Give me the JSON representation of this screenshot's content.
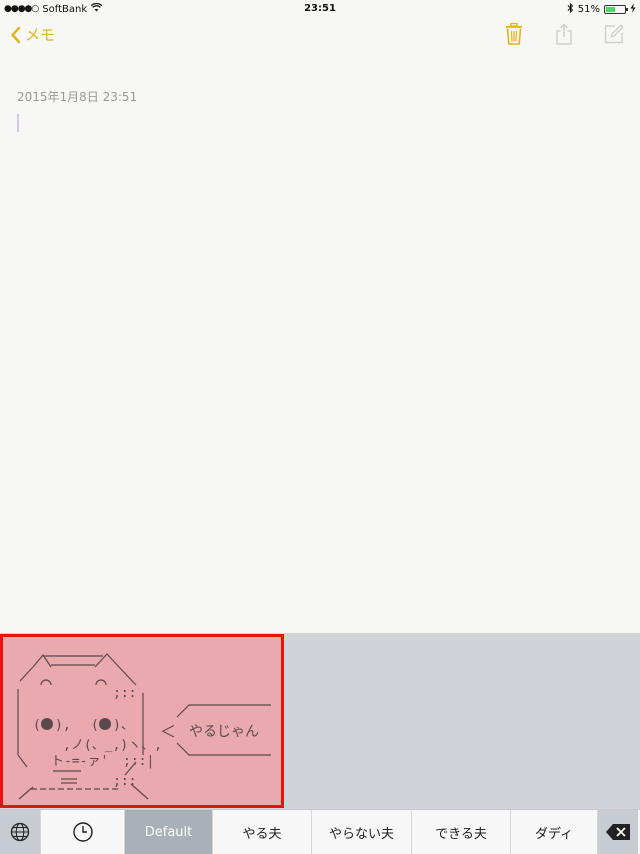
{
  "status_bar": {
    "signal": "●●●●○",
    "carrier": "SoftBank",
    "time": "23:51",
    "battery_percent": "51%",
    "battery_level": 0.51
  },
  "nav": {
    "back_label": "メモ",
    "accent_color": "#e5b318",
    "icons": [
      "trash-icon",
      "share-icon",
      "compose-icon"
    ]
  },
  "note": {
    "date": "2015年1月8日 23:51"
  },
  "aa_panel": {
    "speech_text": "やるじゃん",
    "pointer": "＜"
  },
  "bottom_bar": {
    "tabs": [
      "Default",
      "やる夫",
      "やらない夫",
      "できる夫",
      "ダディ"
    ],
    "selected_tab": "Default"
  }
}
